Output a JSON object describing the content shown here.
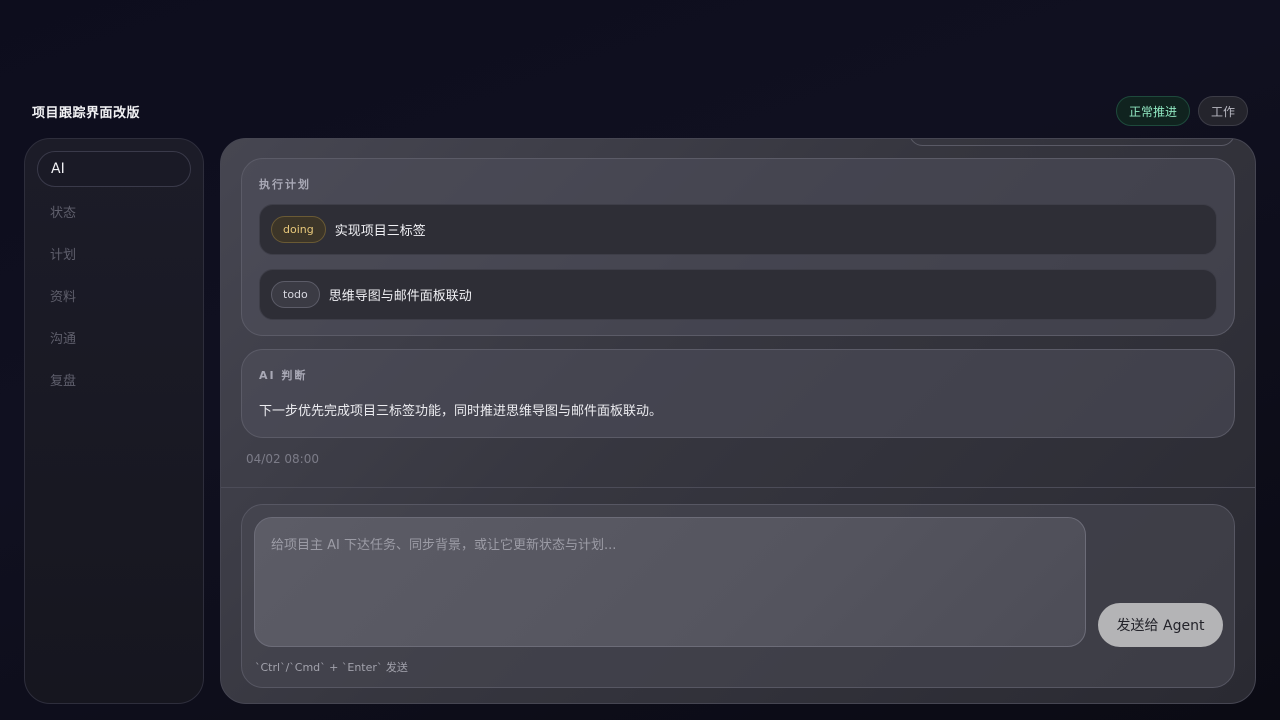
{
  "header": {
    "title": "项目跟踪界面改版",
    "status_badge": "正常推进",
    "category_badge": "工作"
  },
  "sidebar": {
    "items": [
      {
        "label": "AI",
        "active": true
      },
      {
        "label": "状态",
        "active": false
      },
      {
        "label": "计划",
        "active": false
      },
      {
        "label": "资料",
        "active": false
      },
      {
        "label": "沟通",
        "active": false
      },
      {
        "label": "复盘",
        "active": false
      }
    ]
  },
  "plan_card": {
    "heading": "执行计划",
    "items": [
      {
        "status": "doing",
        "text": "实现项目三标签"
      },
      {
        "status": "todo",
        "text": "思维导图与邮件面板联动"
      }
    ]
  },
  "ai_card": {
    "heading": "AI 判断",
    "text": "下一步优先完成项目三标签功能，同时推进思维导图与邮件面板联动。"
  },
  "message_time": "04/02 08:00",
  "composer": {
    "placeholder": "给项目主 AI 下达任务、同步背景，或让它更新状态与计划...",
    "value": "",
    "send_label": "发送给 Agent",
    "hint": "`Ctrl`/`Cmd` + `Enter` 发送"
  },
  "colors": {
    "status_green": "#8fe6c0",
    "doing_amber": "#e6c77a",
    "send_button_bg": "#b4b4b6"
  }
}
